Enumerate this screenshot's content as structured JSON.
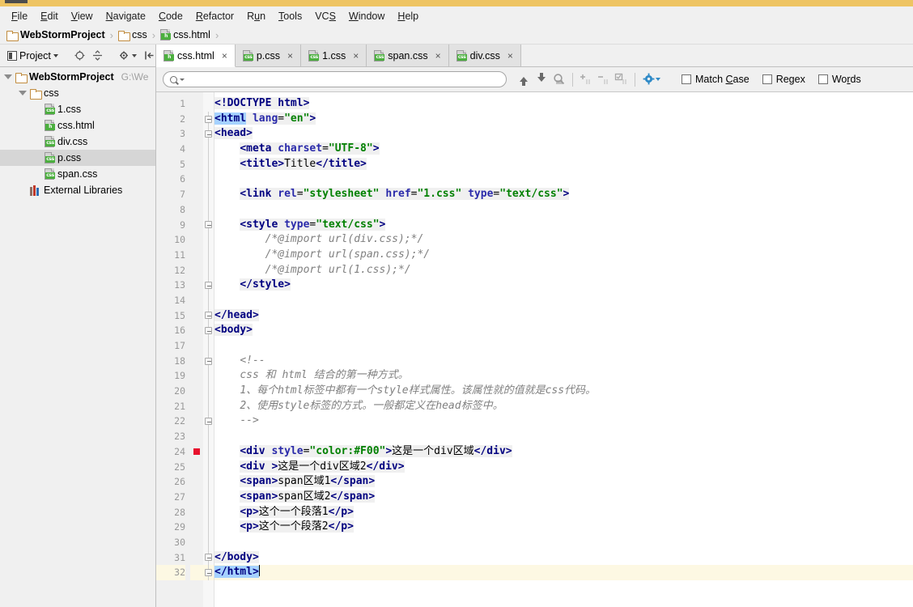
{
  "window": {
    "title_strip_color": "#eec463"
  },
  "menubar": {
    "items": [
      {
        "label": "File",
        "mnemonic": "F"
      },
      {
        "label": "Edit",
        "mnemonic": "E"
      },
      {
        "label": "View",
        "mnemonic": "V"
      },
      {
        "label": "Navigate",
        "mnemonic": "N"
      },
      {
        "label": "Code",
        "mnemonic": "C"
      },
      {
        "label": "Refactor",
        "mnemonic": "R"
      },
      {
        "label": "Run",
        "mnemonic": "u"
      },
      {
        "label": "Tools",
        "mnemonic": "T"
      },
      {
        "label": "VCS",
        "mnemonic": "S"
      },
      {
        "label": "Window",
        "mnemonic": "W"
      },
      {
        "label": "Help",
        "mnemonic": "H"
      }
    ]
  },
  "breadcrumb": {
    "items": [
      {
        "label": "WebStormProject",
        "icon": "folder-icon",
        "bold": true
      },
      {
        "label": "css",
        "icon": "folder-icon",
        "bold": false
      },
      {
        "label": "css.html",
        "icon": "html-file-icon",
        "bold": false
      }
    ],
    "separator": "›"
  },
  "sidebar": {
    "toolbar": {
      "title": "Project",
      "icons": [
        "project-icon",
        "chevron-down-icon",
        "locate-target-icon",
        "collapse-all-icon",
        "settings-gear-icon",
        "hide-panel-icon"
      ]
    },
    "tree": [
      {
        "label": "WebStormProject",
        "path": "G:\\We",
        "icon": "folder-icon",
        "indent": 0,
        "expanded": true,
        "bold": true,
        "selected": false
      },
      {
        "label": "css",
        "path": "",
        "icon": "folder-icon",
        "indent": 1,
        "expanded": true,
        "bold": false,
        "selected": false
      },
      {
        "label": "1.css",
        "path": "",
        "icon": "css-file-icon",
        "indent": 2,
        "expanded": null,
        "bold": false,
        "selected": false
      },
      {
        "label": "css.html",
        "path": "",
        "icon": "html-file-icon",
        "indent": 2,
        "expanded": null,
        "bold": false,
        "selected": false
      },
      {
        "label": "div.css",
        "path": "",
        "icon": "css-file-icon",
        "indent": 2,
        "expanded": null,
        "bold": false,
        "selected": false
      },
      {
        "label": "p.css",
        "path": "",
        "icon": "css-file-icon",
        "indent": 2,
        "expanded": null,
        "bold": false,
        "selected": true
      },
      {
        "label": "span.css",
        "path": "",
        "icon": "css-file-icon",
        "indent": 2,
        "expanded": null,
        "bold": false,
        "selected": false
      },
      {
        "label": "External Libraries",
        "path": "",
        "icon": "libraries-icon",
        "indent": 1,
        "expanded": null,
        "bold": false,
        "selected": false
      }
    ]
  },
  "tabs": [
    {
      "label": "css.html",
      "icon": "html-file-icon",
      "active": true,
      "close": "×"
    },
    {
      "label": "p.css",
      "icon": "css-file-icon",
      "active": false,
      "close": "×"
    },
    {
      "label": "1.css",
      "icon": "css-file-icon",
      "active": false,
      "close": "×"
    },
    {
      "label": "span.css",
      "icon": "css-file-icon",
      "active": false,
      "close": "×"
    },
    {
      "label": "div.css",
      "icon": "css-file-icon",
      "active": false,
      "close": "×"
    }
  ],
  "findbar": {
    "search_value": "",
    "search_placeholder": "",
    "icons": [
      "search-icon",
      "chevron-down-icon",
      "arrow-up-icon",
      "arrow-down-icon",
      "find-all-icon",
      "add-selection-icon",
      "remove-selection-icon",
      "select-all-occurrences-icon",
      "settings-gear-icon"
    ],
    "checkboxes": [
      {
        "label": "Match Case",
        "mnemonic": "C",
        "checked": false
      },
      {
        "label": "Regex",
        "mnemonic": "",
        "checked": false
      },
      {
        "label": "Words",
        "mnemonic": "r",
        "checked": false
      }
    ]
  },
  "editor": {
    "filename": "css.html",
    "caret_line": 32,
    "breakpoint_lines": [
      24
    ],
    "total_lines": 32,
    "lines": [
      {
        "n": 1,
        "fold": null,
        "indent": 0,
        "text": "<!DOCTYPE html>"
      },
      {
        "n": 2,
        "fold": "minus",
        "indent": 0,
        "text": "<html lang=\"en\">"
      },
      {
        "n": 3,
        "fold": "minus",
        "indent": 0,
        "text": "<head>"
      },
      {
        "n": 4,
        "fold": null,
        "indent": 1,
        "text": "<meta charset=\"UTF-8\">"
      },
      {
        "n": 5,
        "fold": null,
        "indent": 1,
        "text": "<title>Title</title>"
      },
      {
        "n": 6,
        "fold": null,
        "indent": 0,
        "text": ""
      },
      {
        "n": 7,
        "fold": null,
        "indent": 1,
        "text": "<link rel=\"stylesheet\" href=\"1.css\" type=\"text/css\">"
      },
      {
        "n": 8,
        "fold": null,
        "indent": 0,
        "text": ""
      },
      {
        "n": 9,
        "fold": "minus",
        "indent": 1,
        "text": "<style type=\"text/css\">"
      },
      {
        "n": 10,
        "fold": null,
        "indent": 2,
        "text": "/*@import url(div.css);*/"
      },
      {
        "n": 11,
        "fold": null,
        "indent": 2,
        "text": "/*@import url(span.css);*/"
      },
      {
        "n": 12,
        "fold": null,
        "indent": 2,
        "text": "/*@import url(1.css);*/"
      },
      {
        "n": 13,
        "fold": "minus",
        "indent": 1,
        "text": "</style>"
      },
      {
        "n": 14,
        "fold": null,
        "indent": 0,
        "text": ""
      },
      {
        "n": 15,
        "fold": "minus",
        "indent": 0,
        "text": "</head>"
      },
      {
        "n": 16,
        "fold": "minus",
        "indent": 0,
        "text": "<body>"
      },
      {
        "n": 17,
        "fold": null,
        "indent": 0,
        "text": ""
      },
      {
        "n": 18,
        "fold": "minus",
        "indent": 1,
        "text": "<!--"
      },
      {
        "n": 19,
        "fold": null,
        "indent": 1,
        "text": "css 和 html 结合的第一种方式。"
      },
      {
        "n": 20,
        "fold": null,
        "indent": 1,
        "text": "1、每个html标签中都有一个style样式属性。该属性就的值就是css代码。"
      },
      {
        "n": 21,
        "fold": null,
        "indent": 1,
        "text": "2、使用style标签的方式。一般都定义在head标签中。"
      },
      {
        "n": 22,
        "fold": "minus",
        "indent": 1,
        "text": "-->"
      },
      {
        "n": 23,
        "fold": null,
        "indent": 0,
        "text": ""
      },
      {
        "n": 24,
        "fold": null,
        "indent": 1,
        "text": "<div style=\"color:#F00\">这是一个div区域</div>"
      },
      {
        "n": 25,
        "fold": null,
        "indent": 1,
        "text": "<div >这是一个div区域2</div>"
      },
      {
        "n": 26,
        "fold": null,
        "indent": 1,
        "text": "<span>span区域1</span>"
      },
      {
        "n": 27,
        "fold": null,
        "indent": 1,
        "text": "<span>span区域2</span>"
      },
      {
        "n": 28,
        "fold": null,
        "indent": 1,
        "text": "<p>这个一个段落1</p>"
      },
      {
        "n": 29,
        "fold": null,
        "indent": 1,
        "text": "<p>这个一个段落2</p>"
      },
      {
        "n": 30,
        "fold": null,
        "indent": 0,
        "text": ""
      },
      {
        "n": 31,
        "fold": "minus",
        "indent": 0,
        "text": "</body>"
      },
      {
        "n": 32,
        "fold": "minus",
        "indent": 0,
        "text": "</html>"
      }
    ]
  }
}
